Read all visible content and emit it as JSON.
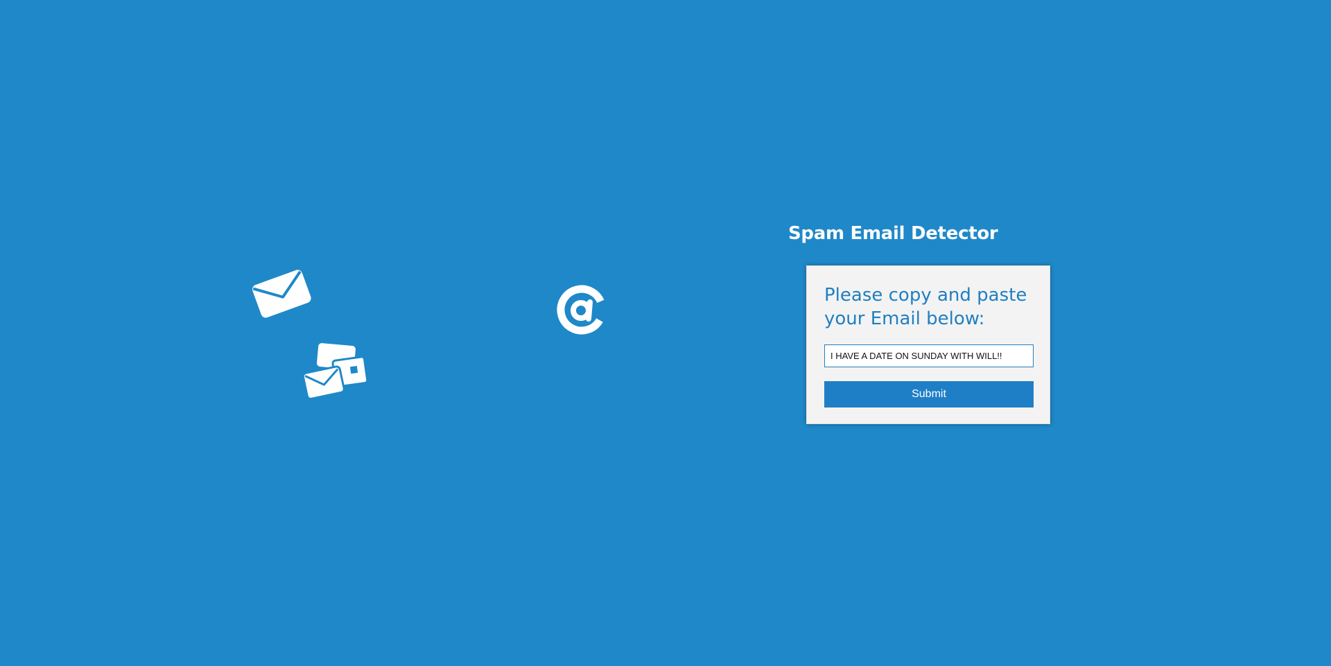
{
  "app": {
    "title": "Spam Email Detector"
  },
  "form": {
    "prompt": "Please copy and paste your Email below:",
    "email_value": "I HAVE A DATE ON SUNDAY WITH WILL!!",
    "submit_label": "Submit"
  },
  "decorations": {
    "icons": [
      "envelope-icon",
      "envelopes-icon",
      "at-sign-icon"
    ],
    "icon_color": "#ffffff"
  },
  "colors": {
    "background": "#1f88c9",
    "accent": "#1f7fc6",
    "card": "#f3f3f3"
  }
}
